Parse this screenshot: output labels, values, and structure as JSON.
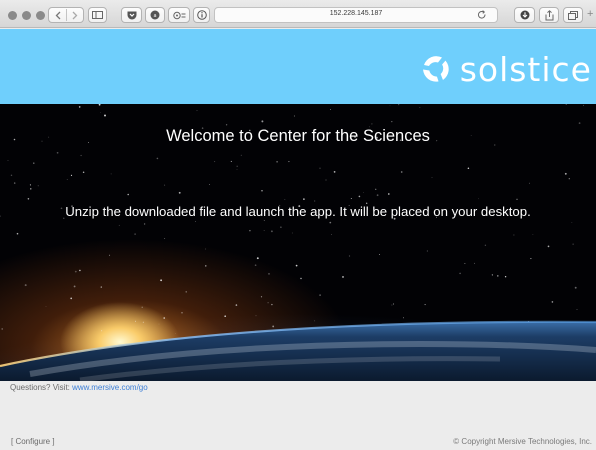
{
  "browser": {
    "url": "152.228.145.187"
  },
  "header": {
    "logo_text": "solstice",
    "brand_color": "#6fcffc"
  },
  "hero": {
    "title": "Welcome to Center for the Sciences",
    "instructions": "Unzip the downloaded file and launch the app. It will be placed on your desktop."
  },
  "footer": {
    "questions_label": "Questions? Visit: ",
    "questions_link": "www.mersive.com/go",
    "configure_label": "[ Configure ]",
    "copyright": "© Copyright Mersive Technologies, Inc."
  }
}
